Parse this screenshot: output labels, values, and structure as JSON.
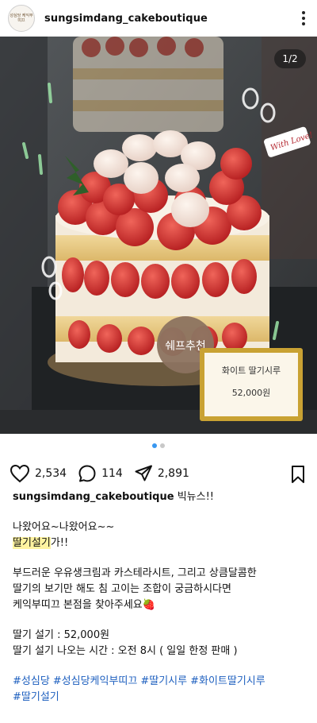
{
  "post": {
    "username": "sungsimdang_cakeboutique",
    "avatar_text": "성심당 케익부띠끄",
    "image_counter": "1/2",
    "tag_chef": "쉐프추천",
    "price_card_name": "화이트 딸기시루",
    "price_card_price": "52,000원",
    "sign_text": "With Love!"
  },
  "actions": {
    "likes": "2,534",
    "comments": "114",
    "shares": "2,891"
  },
  "caption": {
    "username": "sungsimdang_cakeboutique",
    "headline": " 빅뉴스!!",
    "line1": "나왔어요~나왔어요~~",
    "highlight": "딸기설기",
    "line2_rest": "가!!",
    "line3": "부드러운 우유생크림과 카스테라시트, 그리고 상큼달콤한",
    "line4": "딸기의 보기만 해도 침 고이는 조합이 궁금하시다면",
    "line5": "케익부띠끄 본점을 찾아주세요🍓",
    "price_line": "딸기 설기 : 52,000원",
    "time_line": "딸기 설기 나오는 시간 : 오전 8시 ( 일일 한정 판매 )",
    "hashtags": [
      "#성심당",
      "#성심당케익부띠끄",
      "#딸기시루",
      "#화이트딸기시루",
      "#딸기설기"
    ]
  },
  "colors": {
    "link": "#1d5fbf",
    "highlight": "#fff3a0",
    "active_dot": "#3897f0"
  }
}
